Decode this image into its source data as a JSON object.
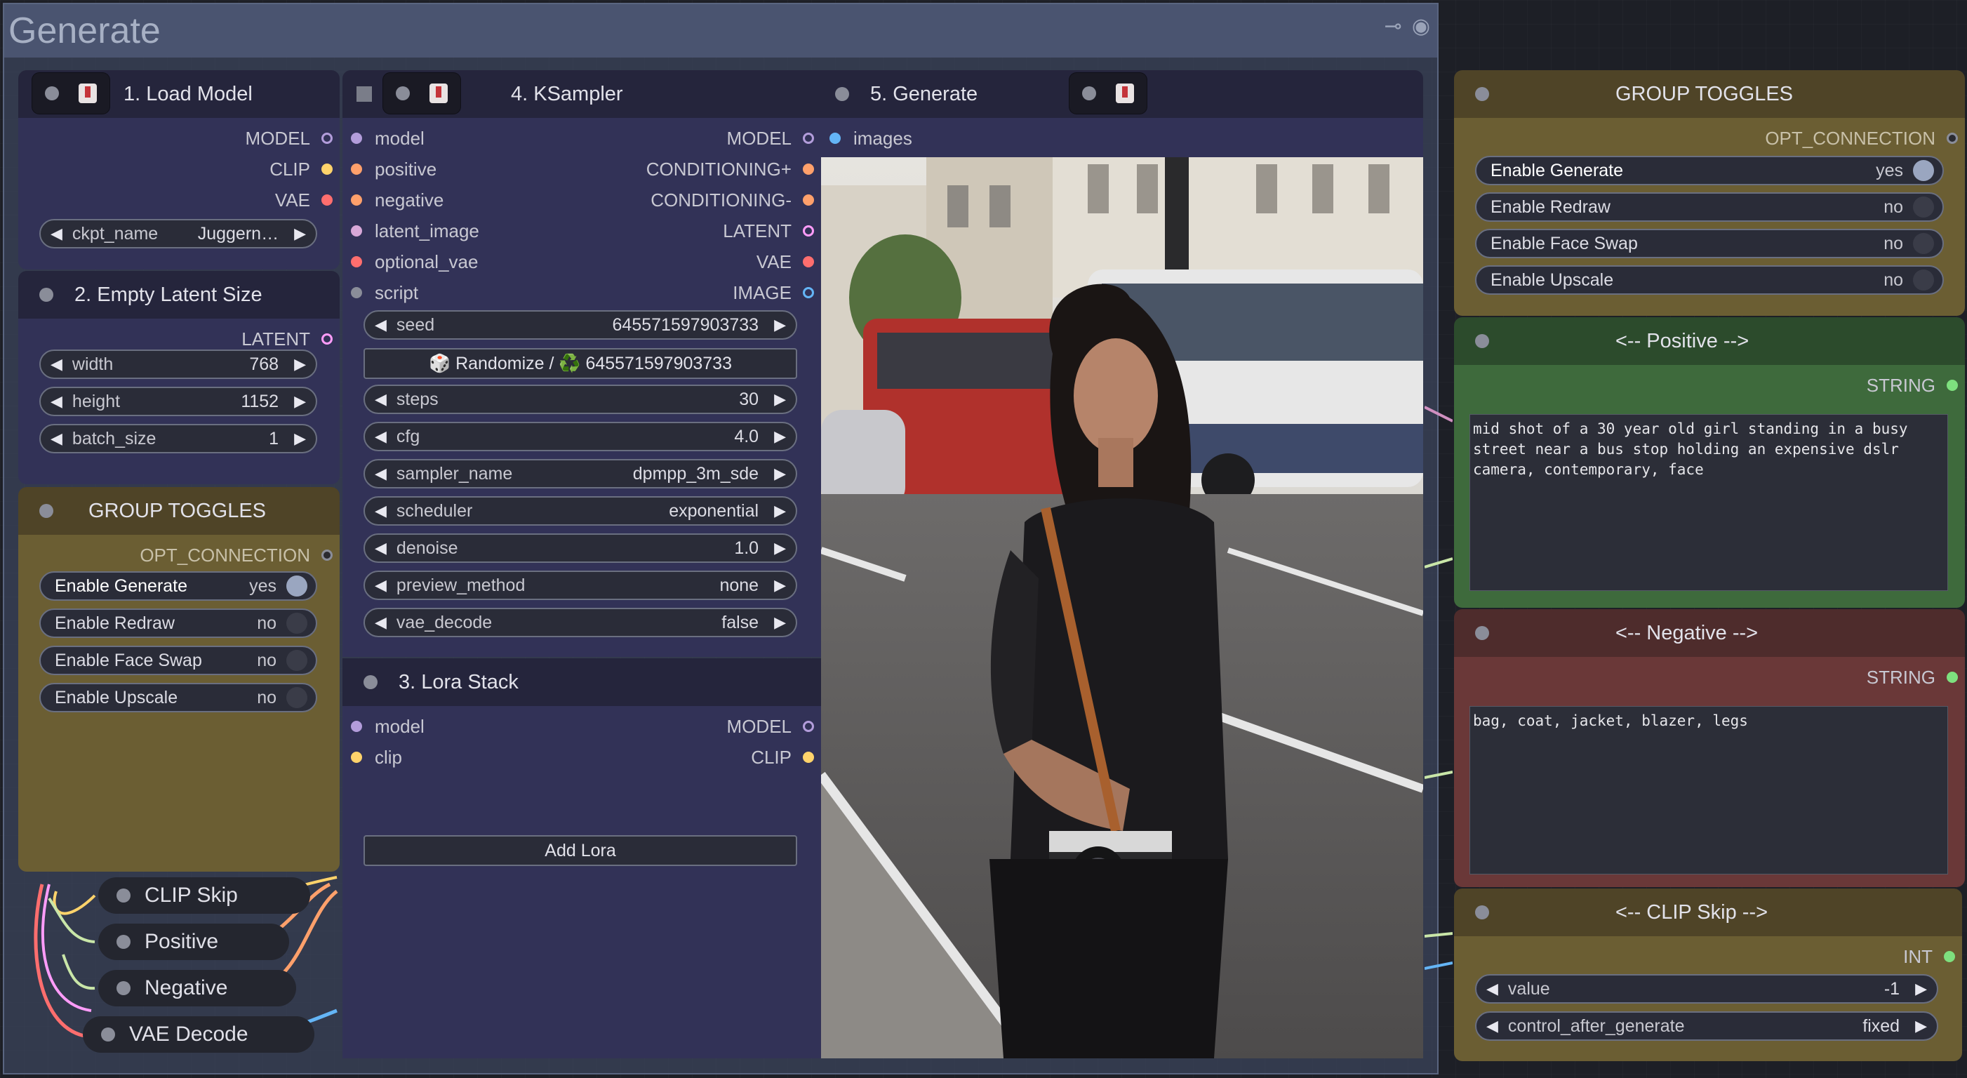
{
  "group": {
    "title": "Generate"
  },
  "load_model": {
    "title": "1. Load Model",
    "outputs": [
      "MODEL",
      "CLIP",
      "VAE"
    ],
    "ckpt_label": "ckpt_name",
    "ckpt_value": "Juggern…"
  },
  "empty_latent": {
    "title": "2. Empty Latent Size",
    "output": "LATENT",
    "widgets": [
      {
        "label": "width",
        "value": "768"
      },
      {
        "label": "height",
        "value": "1152"
      },
      {
        "label": "batch_size",
        "value": "1"
      }
    ]
  },
  "group_toggles_left": {
    "title": "GROUP TOGGLES",
    "output": "OPT_CONNECTION",
    "toggles": [
      {
        "label": "Enable Generate",
        "value": "yes"
      },
      {
        "label": "Enable Redraw",
        "value": "no"
      },
      {
        "label": "Enable Face Swap",
        "value": "no"
      },
      {
        "label": "Enable Upscale",
        "value": "no"
      }
    ]
  },
  "ksampler": {
    "title": "4. KSampler",
    "inputs": [
      "model",
      "positive",
      "negative",
      "latent_image",
      "optional_vae",
      "script"
    ],
    "outputs": [
      "MODEL",
      "CONDITIONING+",
      "CONDITIONING-",
      "LATENT",
      "VAE",
      "IMAGE"
    ],
    "seed_label": "seed",
    "seed_value": "645571597903733",
    "randomize_button": "🎲 Randomize / ♻️ 645571597903733",
    "widgets": [
      {
        "label": "steps",
        "value": "30"
      },
      {
        "label": "cfg",
        "value": "4.0"
      },
      {
        "label": "sampler_name",
        "value": "dpmpp_3m_sde"
      },
      {
        "label": "scheduler",
        "value": "exponential"
      },
      {
        "label": "denoise",
        "value": "1.0"
      },
      {
        "label": "preview_method",
        "value": "none"
      },
      {
        "label": "vae_decode",
        "value": "false"
      }
    ]
  },
  "lora_stack": {
    "title": "3. Lora Stack",
    "inputs": [
      "model",
      "clip"
    ],
    "outputs": [
      "MODEL",
      "CLIP"
    ],
    "add_button": "Add Lora"
  },
  "generate": {
    "title": "5. Generate",
    "input": "images"
  },
  "collapsed": {
    "clip_skip": "CLIP Skip",
    "positive": "Positive",
    "negative": "Negative",
    "vae_decode": "VAE Decode"
  },
  "group_toggles_right": {
    "title": "GROUP TOGGLES",
    "output": "OPT_CONNECTION",
    "toggles": [
      {
        "label": "Enable Generate",
        "value": "yes"
      },
      {
        "label": "Enable Redraw",
        "value": "no"
      },
      {
        "label": "Enable Face Swap",
        "value": "no"
      },
      {
        "label": "Enable Upscale",
        "value": "no"
      }
    ]
  },
  "positive": {
    "title": "<--  Positive  -->",
    "output": "STRING",
    "text": "mid shot of a 30 year old girl standing in a busy street near a bus stop holding an expensive dslr camera, contemporary, face"
  },
  "negative": {
    "title": "<--  Negative  -->",
    "output": "STRING",
    "text": "bag, coat, jacket, blazer, legs"
  },
  "clip_skip": {
    "title": "<--  CLIP Skip  -->",
    "output": "INT",
    "widgets": [
      {
        "label": "value",
        "value": "-1"
      },
      {
        "label": "control_after_generate",
        "value": "fixed"
      }
    ]
  },
  "colors": {
    "model": "#b39ddb",
    "clip": "#ffd36b",
    "vae": "#ff6e6e",
    "conditioning": "#ffa06b",
    "latent": "#ff9cf9",
    "image": "#64b5f6",
    "string": "#7ee07e",
    "int": "#7ee07e",
    "opt": "#8a8d99"
  }
}
